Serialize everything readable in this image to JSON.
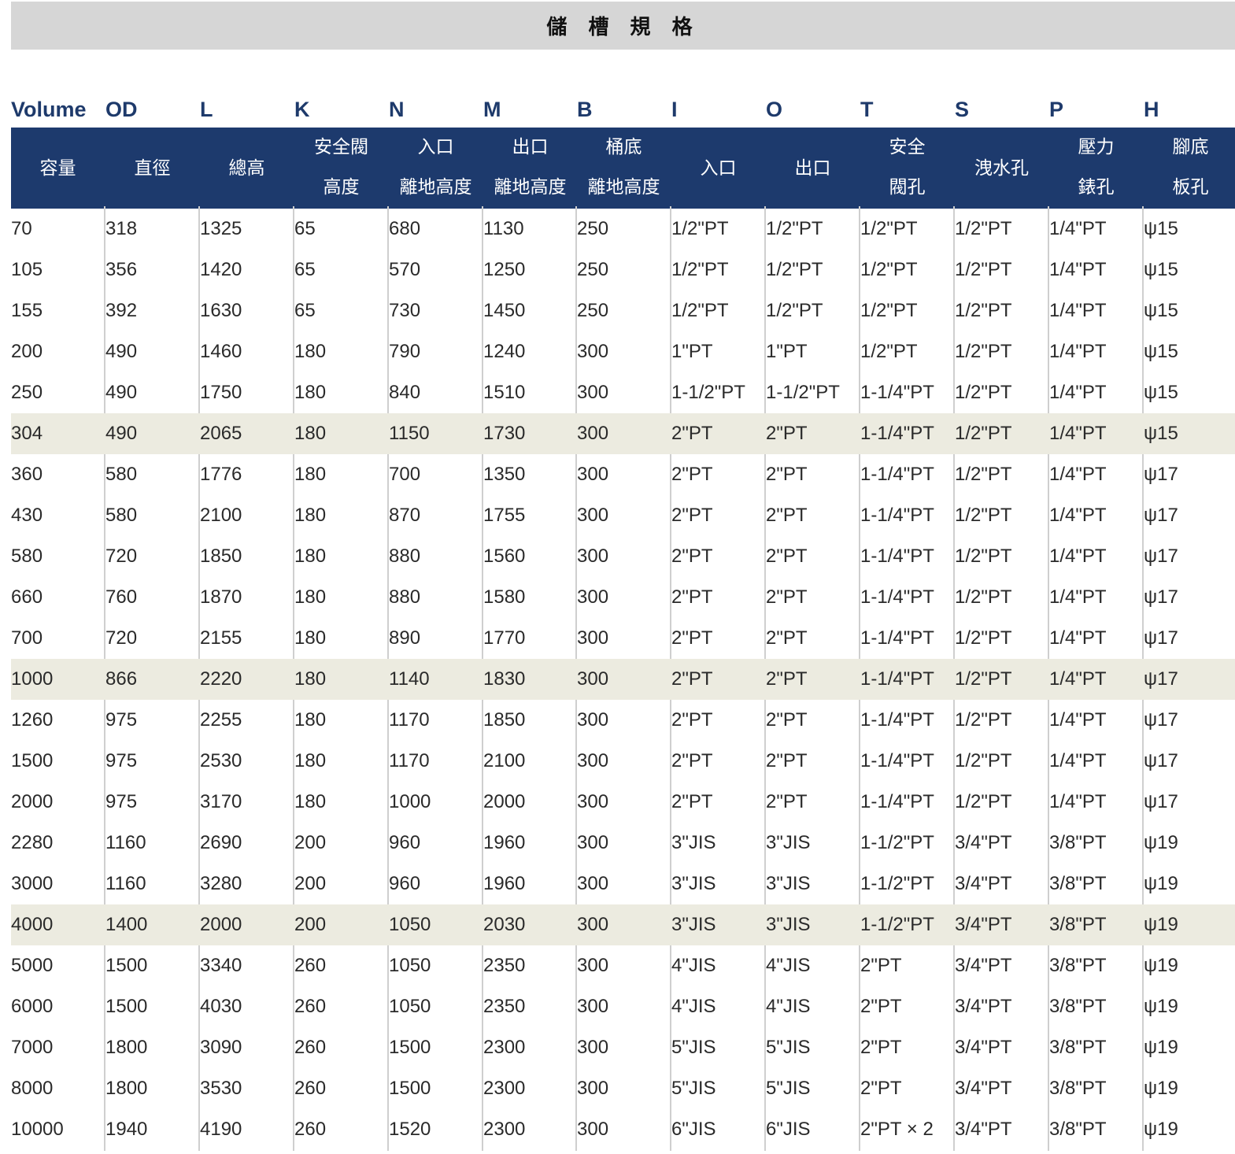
{
  "title": "儲 槽 規 格",
  "columns": [
    {
      "code": "Volume",
      "line1": "容量",
      "line2": ""
    },
    {
      "code": "OD",
      "line1": "直徑",
      "line2": ""
    },
    {
      "code": "L",
      "line1": "總高",
      "line2": ""
    },
    {
      "code": "K",
      "line1": "安全閥",
      "line2": "高度"
    },
    {
      "code": "N",
      "line1": "入口",
      "line2": "離地高度"
    },
    {
      "code": "M",
      "line1": "出口",
      "line2": "離地高度"
    },
    {
      "code": "B",
      "line1": "桶底",
      "line2": "離地高度"
    },
    {
      "code": "I",
      "line1": "入口",
      "line2": ""
    },
    {
      "code": "O",
      "line1": "出口",
      "line2": ""
    },
    {
      "code": "T",
      "line1": "安全",
      "line2": "閥孔"
    },
    {
      "code": "S",
      "line1": "洩水孔",
      "line2": ""
    },
    {
      "code": "P",
      "line1": "壓力",
      "line2": "錶孔"
    },
    {
      "code": "H",
      "line1": "腳底",
      "line2": "板孔"
    }
  ],
  "rows": [
    {
      "highlight": false,
      "cells": [
        "70",
        "318",
        "1325",
        "65",
        "680",
        "1130",
        "250",
        "1/2\"PT",
        "1/2\"PT",
        "1/2\"PT",
        "1/2\"PT",
        "1/4\"PT",
        "ψ15"
      ]
    },
    {
      "highlight": false,
      "cells": [
        "105",
        "356",
        "1420",
        "65",
        "570",
        "1250",
        "250",
        "1/2\"PT",
        "1/2\"PT",
        "1/2\"PT",
        "1/2\"PT",
        "1/4\"PT",
        "ψ15"
      ]
    },
    {
      "highlight": false,
      "cells": [
        "155",
        "392",
        "1630",
        "65",
        "730",
        "1450",
        "250",
        "1/2\"PT",
        "1/2\"PT",
        "1/2\"PT",
        "1/2\"PT",
        "1/4\"PT",
        "ψ15"
      ]
    },
    {
      "highlight": false,
      "cells": [
        "200",
        "490",
        "1460",
        "180",
        "790",
        "1240",
        "300",
        "1\"PT",
        "1\"PT",
        "1/2\"PT",
        "1/2\"PT",
        "1/4\"PT",
        "ψ15"
      ]
    },
    {
      "highlight": false,
      "cells": [
        "250",
        "490",
        "1750",
        "180",
        "840",
        "1510",
        "300",
        "1-1/2\"PT",
        "1-1/2\"PT",
        "1-1/4\"PT",
        "1/2\"PT",
        "1/4\"PT",
        "ψ15"
      ]
    },
    {
      "highlight": true,
      "cells": [
        "304",
        "490",
        "2065",
        "180",
        "1150",
        "1730",
        "300",
        "2\"PT",
        "2\"PT",
        "1-1/4\"PT",
        "1/2\"PT",
        "1/4\"PT",
        "ψ15"
      ]
    },
    {
      "highlight": false,
      "cells": [
        "360",
        "580",
        "1776",
        "180",
        "700",
        "1350",
        "300",
        "2\"PT",
        "2\"PT",
        "1-1/4\"PT",
        "1/2\"PT",
        "1/4\"PT",
        "ψ17"
      ]
    },
    {
      "highlight": false,
      "cells": [
        "430",
        "580",
        "2100",
        "180",
        "870",
        "1755",
        "300",
        "2\"PT",
        "2\"PT",
        "1-1/4\"PT",
        "1/2\"PT",
        "1/4\"PT",
        "ψ17"
      ]
    },
    {
      "highlight": false,
      "cells": [
        "580",
        "720",
        "1850",
        "180",
        "880",
        "1560",
        "300",
        "2\"PT",
        "2\"PT",
        "1-1/4\"PT",
        "1/2\"PT",
        "1/4\"PT",
        "ψ17"
      ]
    },
    {
      "highlight": false,
      "cells": [
        "660",
        "760",
        "1870",
        "180",
        "880",
        "1580",
        "300",
        "2\"PT",
        "2\"PT",
        "1-1/4\"PT",
        "1/2\"PT",
        "1/4\"PT",
        "ψ17"
      ]
    },
    {
      "highlight": false,
      "cells": [
        "700",
        "720",
        "2155",
        "180",
        "890",
        "1770",
        "300",
        "2\"PT",
        "2\"PT",
        "1-1/4\"PT",
        "1/2\"PT",
        "1/4\"PT",
        "ψ17"
      ]
    },
    {
      "highlight": true,
      "cells": [
        "1000",
        "866",
        "2220",
        "180",
        "1140",
        "1830",
        "300",
        "2\"PT",
        "2\"PT",
        "1-1/4\"PT",
        "1/2\"PT",
        "1/4\"PT",
        "ψ17"
      ]
    },
    {
      "highlight": false,
      "cells": [
        "1260",
        "975",
        "2255",
        "180",
        "1170",
        "1850",
        "300",
        "2\"PT",
        "2\"PT",
        "1-1/4\"PT",
        "1/2\"PT",
        "1/4\"PT",
        "ψ17"
      ]
    },
    {
      "highlight": false,
      "cells": [
        "1500",
        "975",
        "2530",
        "180",
        "1170",
        "2100",
        "300",
        "2\"PT",
        "2\"PT",
        "1-1/4\"PT",
        "1/2\"PT",
        "1/4\"PT",
        "ψ17"
      ]
    },
    {
      "highlight": false,
      "cells": [
        "2000",
        "975",
        "3170",
        "180",
        "1000",
        "2000",
        "300",
        "2\"PT",
        "2\"PT",
        "1-1/4\"PT",
        "1/2\"PT",
        "1/4\"PT",
        "ψ17"
      ]
    },
    {
      "highlight": false,
      "cells": [
        "2280",
        "1160",
        "2690",
        "200",
        "960",
        "1960",
        "300",
        "3\"JIS",
        "3\"JIS",
        "1-1/2\"PT",
        "3/4\"PT",
        "3/8\"PT",
        "ψ19"
      ]
    },
    {
      "highlight": false,
      "cells": [
        "3000",
        "1160",
        "3280",
        "200",
        "960",
        "1960",
        "300",
        "3\"JIS",
        "3\"JIS",
        "1-1/2\"PT",
        "3/4\"PT",
        "3/8\"PT",
        "ψ19"
      ]
    },
    {
      "highlight": true,
      "cells": [
        "4000",
        "1400",
        "2000",
        "200",
        "1050",
        "2030",
        "300",
        "3\"JIS",
        "3\"JIS",
        "1-1/2\"PT",
        "3/4\"PT",
        "3/8\"PT",
        "ψ19"
      ]
    },
    {
      "highlight": false,
      "cells": [
        "5000",
        "1500",
        "3340",
        "260",
        "1050",
        "2350",
        "300",
        "4\"JIS",
        "4\"JIS",
        "2\"PT",
        "3/4\"PT",
        "3/8\"PT",
        "ψ19"
      ]
    },
    {
      "highlight": false,
      "cells": [
        "6000",
        "1500",
        "4030",
        "260",
        "1050",
        "2350",
        "300",
        "4\"JIS",
        "4\"JIS",
        "2\"PT",
        "3/4\"PT",
        "3/8\"PT",
        "ψ19"
      ]
    },
    {
      "highlight": false,
      "cells": [
        "7000",
        "1800",
        "3090",
        "260",
        "1500",
        "2300",
        "300",
        "5\"JIS",
        "5\"JIS",
        "2\"PT",
        "3/4\"PT",
        "3/8\"PT",
        "ψ19"
      ]
    },
    {
      "highlight": false,
      "cells": [
        "8000",
        "1800",
        "3530",
        "260",
        "1500",
        "2300",
        "300",
        "5\"JIS",
        "5\"JIS",
        "2\"PT",
        "3/4\"PT",
        "3/8\"PT",
        "ψ19"
      ]
    },
    {
      "highlight": false,
      "cells": [
        "10000",
        "1940",
        "4190",
        "260",
        "1520",
        "2300",
        "300",
        "6\"JIS",
        "6\"JIS",
        "2\"PT × 2",
        "3/4\"PT",
        "3/8\"PT",
        "ψ19"
      ]
    }
  ]
}
